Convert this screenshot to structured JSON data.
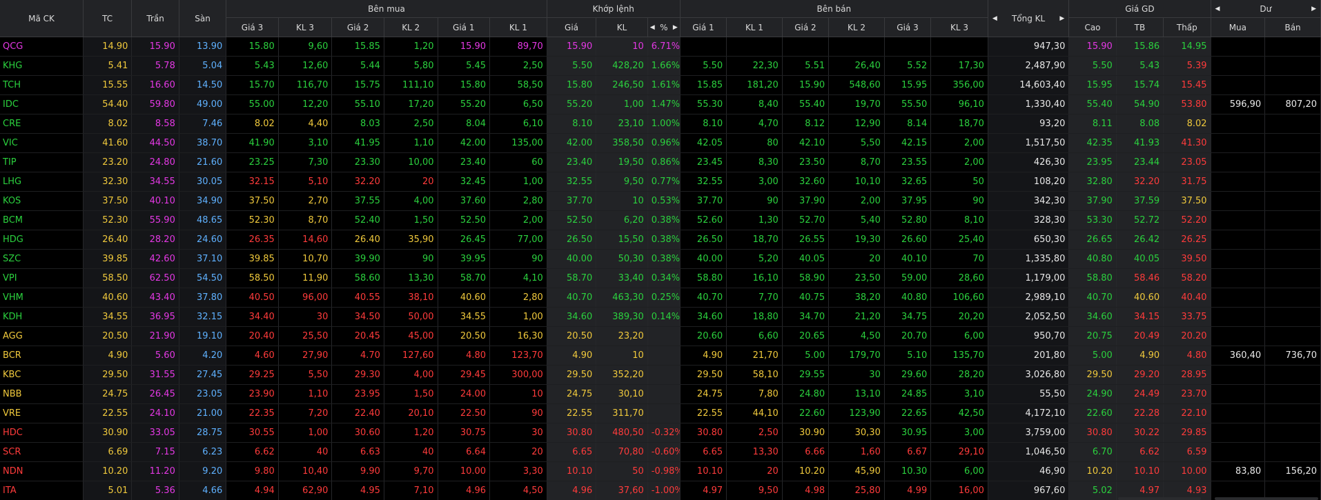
{
  "headers": {
    "symbol": "Mã CK",
    "ref": "TC",
    "ceiling": "Trần",
    "floor": "Sàn",
    "buy_side": "Bên mua",
    "matched": "Khớp lệnh",
    "sell_side": "Bên bán",
    "total_vol": "Tổng KL",
    "price_range": "Giá GD",
    "foreign": "Dư",
    "buy": {
      "p3": "Giá 3",
      "v3": "KL 3",
      "p2": "Giá 2",
      "v2": "KL 2",
      "p1": "Giá 1",
      "v1": "KL 1"
    },
    "match": {
      "price": "Giá",
      "vol": "KL",
      "pct": "%"
    },
    "sell": {
      "p1": "Giá 1",
      "v1": "KL 1",
      "p2": "Giá 2",
      "v2": "KL 2",
      "p3": "Giá 3",
      "v3": "KL 3"
    },
    "range": {
      "high": "Cao",
      "avg": "TB",
      "low": "Thấp"
    },
    "foreign_cols": {
      "buy": "Mua",
      "sell": "Bán"
    }
  },
  "colors": {
    "ref": "#f0c93c",
    "up": "#2bd13e",
    "down": "#ff3b3b",
    "ceiling": "#e438e4",
    "floor": "#5fb1ff",
    "neutral": "#e8e8e8"
  },
  "rows": [
    {
      "sym": "QCG",
      "ref": "14.90",
      "ceil": "15.90",
      "floor": "13.90",
      "b3p": "15.80",
      "b3v": "9,60",
      "b2p": "15.85",
      "b2v": "1,20",
      "b1p": "15.90",
      "b1v": "89,70",
      "mp": "15.90",
      "mv": "10",
      "pct": "6.71%",
      "s1p": "",
      "s1v": "",
      "s2p": "",
      "s2v": "",
      "s3p": "",
      "s3v": "",
      "tot": "947,30",
      "hi": "15.90",
      "avg": "15.86",
      "lo": "14.95",
      "fb": "",
      "fs": ""
    },
    {
      "sym": "KHG",
      "ref": "5.41",
      "ceil": "5.78",
      "floor": "5.04",
      "b3p": "5.43",
      "b3v": "12,60",
      "b2p": "5.44",
      "b2v": "5,80",
      "b1p": "5.45",
      "b1v": "2,50",
      "mp": "5.50",
      "mv": "428,20",
      "pct": "1.66%",
      "s1p": "5.50",
      "s1v": "22,30",
      "s2p": "5.51",
      "s2v": "26,40",
      "s3p": "5.52",
      "s3v": "17,30",
      "tot": "2,487,90",
      "hi": "5.50",
      "avg": "5.43",
      "lo": "5.39",
      "fb": "",
      "fs": ""
    },
    {
      "sym": "TCH",
      "ref": "15.55",
      "ceil": "16.60",
      "floor": "14.50",
      "b3p": "15.70",
      "b3v": "116,70",
      "b2p": "15.75",
      "b2v": "111,10",
      "b1p": "15.80",
      "b1v": "58,50",
      "mp": "15.80",
      "mv": "246,50",
      "pct": "1.61%",
      "s1p": "15.85",
      "s1v": "181,20",
      "s2p": "15.90",
      "s2v": "548,60",
      "s3p": "15.95",
      "s3v": "356,00",
      "tot": "14,603,40",
      "hi": "15.95",
      "avg": "15.74",
      "lo": "15.45",
      "fb": "",
      "fs": ""
    },
    {
      "sym": "IDC",
      "ref": "54.40",
      "ceil": "59.80",
      "floor": "49.00",
      "b3p": "55.00",
      "b3v": "12,20",
      "b2p": "55.10",
      "b2v": "17,20",
      "b1p": "55.20",
      "b1v": "6,50",
      "mp": "55.20",
      "mv": "1,00",
      "pct": "1.47%",
      "s1p": "55.30",
      "s1v": "8,40",
      "s2p": "55.40",
      "s2v": "19,70",
      "s3p": "55.50",
      "s3v": "96,10",
      "tot": "1,330,40",
      "hi": "55.40",
      "avg": "54.90",
      "lo": "53.80",
      "fb": "596,90",
      "fs": "807,20"
    },
    {
      "sym": "CRE",
      "ref": "8.02",
      "ceil": "8.58",
      "floor": "7.46",
      "b3p": "8.02",
      "b3v": "4,40",
      "b2p": "8.03",
      "b2v": "2,50",
      "b1p": "8.04",
      "b1v": "6,10",
      "mp": "8.10",
      "mv": "23,10",
      "pct": "1.00%",
      "s1p": "8.10",
      "s1v": "4,70",
      "s2p": "8.12",
      "s2v": "12,90",
      "s3p": "8.14",
      "s3v": "18,70",
      "tot": "93,20",
      "hi": "8.11",
      "avg": "8.08",
      "lo": "8.02",
      "fb": "",
      "fs": ""
    },
    {
      "sym": "VIC",
      "ref": "41.60",
      "ceil": "44.50",
      "floor": "38.70",
      "b3p": "41.90",
      "b3v": "3,10",
      "b2p": "41.95",
      "b2v": "1,10",
      "b1p": "42.00",
      "b1v": "135,00",
      "mp": "42.00",
      "mv": "358,50",
      "pct": "0.96%",
      "s1p": "42.05",
      "s1v": "80",
      "s2p": "42.10",
      "s2v": "5,50",
      "s3p": "42.15",
      "s3v": "2,00",
      "tot": "1,517,50",
      "hi": "42.35",
      "avg": "41.93",
      "lo": "41.30",
      "fb": "",
      "fs": ""
    },
    {
      "sym": "TIP",
      "ref": "23.20",
      "ceil": "24.80",
      "floor": "21.60",
      "b3p": "23.25",
      "b3v": "7,30",
      "b2p": "23.30",
      "b2v": "10,00",
      "b1p": "23.40",
      "b1v": "60",
      "mp": "23.40",
      "mv": "19,50",
      "pct": "0.86%",
      "s1p": "23.45",
      "s1v": "8,30",
      "s2p": "23.50",
      "s2v": "8,70",
      "s3p": "23.55",
      "s3v": "2,00",
      "tot": "426,30",
      "hi": "23.95",
      "avg": "23.44",
      "lo": "23.05",
      "fb": "",
      "fs": ""
    },
    {
      "sym": "LHG",
      "ref": "32.30",
      "ceil": "34.55",
      "floor": "30.05",
      "b3p": "32.15",
      "b3v": "5,10",
      "b2p": "32.20",
      "b2v": "20",
      "b1p": "32.45",
      "b1v": "1,00",
      "mp": "32.55",
      "mv": "9,50",
      "pct": "0.77%",
      "s1p": "32.55",
      "s1v": "3,00",
      "s2p": "32.60",
      "s2v": "10,10",
      "s3p": "32.65",
      "s3v": "50",
      "tot": "108,20",
      "hi": "32.80",
      "avg": "32.20",
      "lo": "31.75",
      "fb": "",
      "fs": ""
    },
    {
      "sym": "KOS",
      "ref": "37.50",
      "ceil": "40.10",
      "floor": "34.90",
      "b3p": "37.50",
      "b3v": "2,70",
      "b2p": "37.55",
      "b2v": "4,00",
      "b1p": "37.60",
      "b1v": "2,80",
      "mp": "37.70",
      "mv": "10",
      "pct": "0.53%",
      "s1p": "37.70",
      "s1v": "90",
      "s2p": "37.90",
      "s2v": "2,00",
      "s3p": "37.95",
      "s3v": "90",
      "tot": "342,30",
      "hi": "37.90",
      "avg": "37.59",
      "lo": "37.50",
      "fb": "",
      "fs": ""
    },
    {
      "sym": "BCM",
      "ref": "52.30",
      "ceil": "55.90",
      "floor": "48.65",
      "b3p": "52.30",
      "b3v": "8,70",
      "b2p": "52.40",
      "b2v": "1,50",
      "b1p": "52.50",
      "b1v": "2,00",
      "mp": "52.50",
      "mv": "6,20",
      "pct": "0.38%",
      "s1p": "52.60",
      "s1v": "1,30",
      "s2p": "52.70",
      "s2v": "5,40",
      "s3p": "52.80",
      "s3v": "8,10",
      "tot": "328,30",
      "hi": "53.30",
      "avg": "52.72",
      "lo": "52.20",
      "fb": "",
      "fs": ""
    },
    {
      "sym": "HDG",
      "ref": "26.40",
      "ceil": "28.20",
      "floor": "24.60",
      "b3p": "26.35",
      "b3v": "14,60",
      "b2p": "26.40",
      "b2v": "35,90",
      "b1p": "26.45",
      "b1v": "77,00",
      "mp": "26.50",
      "mv": "15,50",
      "pct": "0.38%",
      "s1p": "26.50",
      "s1v": "18,70",
      "s2p": "26.55",
      "s2v": "19,30",
      "s3p": "26.60",
      "s3v": "25,40",
      "tot": "650,30",
      "hi": "26.65",
      "avg": "26.42",
      "lo": "26.25",
      "fb": "",
      "fs": ""
    },
    {
      "sym": "SZC",
      "ref": "39.85",
      "ceil": "42.60",
      "floor": "37.10",
      "b3p": "39.85",
      "b3v": "10,70",
      "b2p": "39.90",
      "b2v": "90",
      "b1p": "39.95",
      "b1v": "90",
      "mp": "40.00",
      "mv": "50,30",
      "pct": "0.38%",
      "s1p": "40.00",
      "s1v": "5,20",
      "s2p": "40.05",
      "s2v": "20",
      "s3p": "40.10",
      "s3v": "70",
      "tot": "1,335,80",
      "hi": "40.80",
      "avg": "40.05",
      "lo": "39.50",
      "fb": "",
      "fs": ""
    },
    {
      "sym": "VPI",
      "ref": "58.50",
      "ceil": "62.50",
      "floor": "54.50",
      "b3p": "58.50",
      "b3v": "11,90",
      "b2p": "58.60",
      "b2v": "13,30",
      "b1p": "58.70",
      "b1v": "4,10",
      "mp": "58.70",
      "mv": "33,40",
      "pct": "0.34%",
      "s1p": "58.80",
      "s1v": "16,10",
      "s2p": "58.90",
      "s2v": "23,50",
      "s3p": "59.00",
      "s3v": "28,60",
      "tot": "1,179,00",
      "hi": "58.80",
      "avg": "58.46",
      "lo": "58.20",
      "fb": "",
      "fs": ""
    },
    {
      "sym": "VHM",
      "ref": "40.60",
      "ceil": "43.40",
      "floor": "37.80",
      "b3p": "40.50",
      "b3v": "96,00",
      "b2p": "40.55",
      "b2v": "38,10",
      "b1p": "40.60",
      "b1v": "2,80",
      "mp": "40.70",
      "mv": "463,30",
      "pct": "0.25%",
      "s1p": "40.70",
      "s1v": "7,70",
      "s2p": "40.75",
      "s2v": "38,20",
      "s3p": "40.80",
      "s3v": "106,60",
      "tot": "2,989,10",
      "hi": "40.70",
      "avg": "40.60",
      "lo": "40.40",
      "fb": "",
      "fs": ""
    },
    {
      "sym": "KDH",
      "ref": "34.55",
      "ceil": "36.95",
      "floor": "32.15",
      "b3p": "34.40",
      "b3v": "30",
      "b2p": "34.50",
      "b2v": "50,00",
      "b1p": "34.55",
      "b1v": "1,00",
      "mp": "34.60",
      "mv": "389,30",
      "pct": "0.14%",
      "s1p": "34.60",
      "s1v": "18,80",
      "s2p": "34.70",
      "s2v": "21,20",
      "s3p": "34.75",
      "s3v": "20,20",
      "tot": "2,052,50",
      "hi": "34.60",
      "avg": "34.15",
      "lo": "33.75",
      "fb": "",
      "fs": ""
    },
    {
      "sym": "AGG",
      "ref": "20.50",
      "ceil": "21.90",
      "floor": "19.10",
      "b3p": "20.40",
      "b3v": "25,50",
      "b2p": "20.45",
      "b2v": "45,00",
      "b1p": "20.50",
      "b1v": "16,30",
      "mp": "20.50",
      "mv": "23,20",
      "pct": "",
      "s1p": "20.60",
      "s1v": "6,60",
      "s2p": "20.65",
      "s2v": "4,50",
      "s3p": "20.70",
      "s3v": "6,00",
      "tot": "950,70",
      "hi": "20.75",
      "avg": "20.49",
      "lo": "20.20",
      "fb": "",
      "fs": ""
    },
    {
      "sym": "BCR",
      "ref": "4.90",
      "ceil": "5.60",
      "floor": "4.20",
      "b3p": "4.60",
      "b3v": "27,90",
      "b2p": "4.70",
      "b2v": "127,60",
      "b1p": "4.80",
      "b1v": "123,70",
      "mp": "4.90",
      "mv": "10",
      "pct": "",
      "s1p": "4.90",
      "s1v": "21,70",
      "s2p": "5.00",
      "s2v": "179,70",
      "s3p": "5.10",
      "s3v": "135,70",
      "tot": "201,80",
      "hi": "5.00",
      "avg": "4.90",
      "lo": "4.80",
      "fb": "360,40",
      "fs": "736,70"
    },
    {
      "sym": "KBC",
      "ref": "29.50",
      "ceil": "31.55",
      "floor": "27.45",
      "b3p": "29.25",
      "b3v": "5,50",
      "b2p": "29.30",
      "b2v": "4,00",
      "b1p": "29.45",
      "b1v": "300,00",
      "mp": "29.50",
      "mv": "352,20",
      "pct": "",
      "s1p": "29.50",
      "s1v": "58,10",
      "s2p": "29.55",
      "s2v": "30",
      "s3p": "29.60",
      "s3v": "28,20",
      "tot": "3,026,80",
      "hi": "29.50",
      "avg": "29.20",
      "lo": "28.95",
      "fb": "",
      "fs": ""
    },
    {
      "sym": "NBB",
      "ref": "24.75",
      "ceil": "26.45",
      "floor": "23.05",
      "b3p": "23.90",
      "b3v": "1,10",
      "b2p": "23.95",
      "b2v": "1,50",
      "b1p": "24.00",
      "b1v": "10",
      "mp": "24.75",
      "mv": "30,10",
      "pct": "",
      "s1p": "24.75",
      "s1v": "7,80",
      "s2p": "24.80",
      "s2v": "13,10",
      "s3p": "24.85",
      "s3v": "3,10",
      "tot": "55,50",
      "hi": "24.90",
      "avg": "24.49",
      "lo": "23.70",
      "fb": "",
      "fs": ""
    },
    {
      "sym": "VRE",
      "ref": "22.55",
      "ceil": "24.10",
      "floor": "21.00",
      "b3p": "22.35",
      "b3v": "7,20",
      "b2p": "22.40",
      "b2v": "20,10",
      "b1p": "22.50",
      "b1v": "90",
      "mp": "22.55",
      "mv": "311,70",
      "pct": "",
      "s1p": "22.55",
      "s1v": "44,10",
      "s2p": "22.60",
      "s2v": "123,90",
      "s3p": "22.65",
      "s3v": "42,50",
      "tot": "4,172,10",
      "hi": "22.60",
      "avg": "22.28",
      "lo": "22.10",
      "fb": "",
      "fs": ""
    },
    {
      "sym": "HDC",
      "ref": "30.90",
      "ceil": "33.05",
      "floor": "28.75",
      "b3p": "30.55",
      "b3v": "1,00",
      "b2p": "30.60",
      "b2v": "1,20",
      "b1p": "30.75",
      "b1v": "30",
      "mp": "30.80",
      "mv": "480,50",
      "pct": "-0.32%",
      "s1p": "30.80",
      "s1v": "2,50",
      "s2p": "30.90",
      "s2v": "30,30",
      "s3p": "30.95",
      "s3v": "3,00",
      "tot": "3,759,00",
      "hi": "30.80",
      "avg": "30.22",
      "lo": "29.85",
      "fb": "",
      "fs": ""
    },
    {
      "sym": "SCR",
      "ref": "6.69",
      "ceil": "7.15",
      "floor": "6.23",
      "b3p": "6.62",
      "b3v": "40",
      "b2p": "6.63",
      "b2v": "40",
      "b1p": "6.64",
      "b1v": "20",
      "mp": "6.65",
      "mv": "70,80",
      "pct": "-0.60%",
      "s1p": "6.65",
      "s1v": "13,30",
      "s2p": "6.66",
      "s2v": "1,60",
      "s3p": "6.67",
      "s3v": "29,10",
      "tot": "1,046,50",
      "hi": "6.70",
      "avg": "6.62",
      "lo": "6.59",
      "fb": "",
      "fs": ""
    },
    {
      "sym": "NDN",
      "ref": "10.20",
      "ceil": "11.20",
      "floor": "9.20",
      "b3p": "9.80",
      "b3v": "10,40",
      "b2p": "9.90",
      "b2v": "9,70",
      "b1p": "10.00",
      "b1v": "3,30",
      "mp": "10.10",
      "mv": "50",
      "pct": "-0.98%",
      "s1p": "10.10",
      "s1v": "20",
      "s2p": "10.20",
      "s2v": "45,90",
      "s3p": "10.30",
      "s3v": "6,00",
      "tot": "46,90",
      "hi": "10.20",
      "avg": "10.10",
      "lo": "10.00",
      "fb": "83,80",
      "fs": "156,20"
    },
    {
      "sym": "ITA",
      "ref": "5.01",
      "ceil": "5.36",
      "floor": "4.66",
      "b3p": "4.94",
      "b3v": "62,90",
      "b2p": "4.95",
      "b2v": "7,10",
      "b1p": "4.96",
      "b1v": "4,50",
      "mp": "4.96",
      "mv": "37,60",
      "pct": "-1.00%",
      "s1p": "4.97",
      "s1v": "9,50",
      "s2p": "4.98",
      "s2v": "25,80",
      "s3p": "4.99",
      "s3v": "16,00",
      "tot": "967,60",
      "hi": "5.02",
      "avg": "4.97",
      "lo": "4.93",
      "fb": "",
      "fs": ""
    }
  ]
}
